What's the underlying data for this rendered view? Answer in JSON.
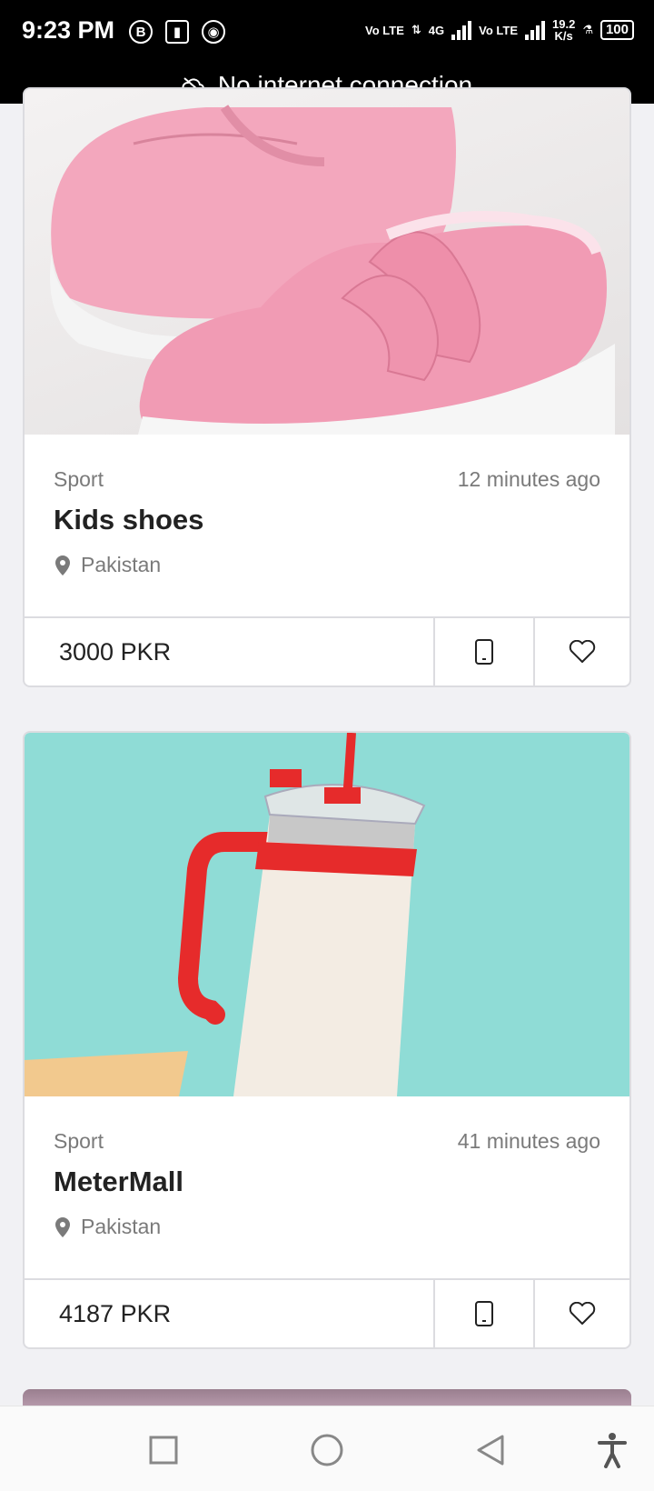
{
  "status_bar": {
    "time": "9:23 PM",
    "net_speed": "19.2",
    "net_speed_unit": "K/s",
    "battery": "100",
    "network_1": "Vo LTE",
    "network_2": "4G",
    "network_3": "Vo LTE"
  },
  "banner": {
    "text": "No internet connection"
  },
  "listings": [
    {
      "category": "Sport",
      "time": "12 minutes ago",
      "title": "Kids shoes",
      "location": "Pakistan",
      "price": "3000 PKR"
    },
    {
      "category": "Sport",
      "time": "41 minutes ago",
      "title": "MeterMall",
      "location": "Pakistan",
      "price": "4187 PKR"
    }
  ],
  "colors": {
    "accent_pink": "#f2a0b8",
    "teal_bg": "#8fdcd6",
    "red_handle": "#e62b2b"
  }
}
